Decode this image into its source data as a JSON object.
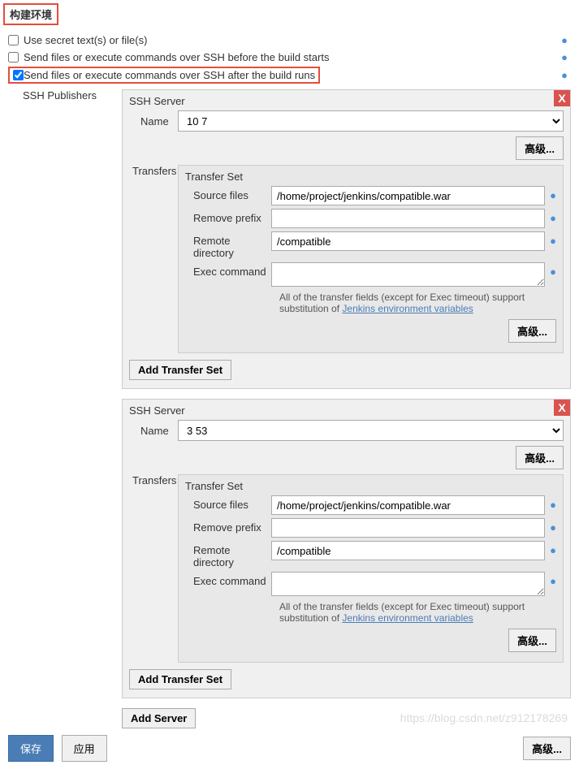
{
  "section_title": "构建环境",
  "checkboxes": {
    "use_secret": {
      "label": "Use secret text(s) or file(s)",
      "checked": false
    },
    "before_build": {
      "label": "Send files or execute commands over SSH before the build starts",
      "checked": false
    },
    "after_build": {
      "label": "Send files or execute commands over SSH after the build runs",
      "checked": true
    }
  },
  "publishers_label": "SSH Publishers",
  "buttons": {
    "advanced": "高级...",
    "add_transfer": "Add Transfer Set",
    "add_server": "Add Server",
    "save": "保存",
    "apply": "应用"
  },
  "close_label": "X",
  "ssh": {
    "server_title": "SSH Server",
    "name_label": "Name",
    "transfers_label": "Transfers",
    "transfer_set_title": "Transfer Set",
    "source_files_label": "Source files",
    "remove_prefix_label": "Remove prefix",
    "remote_dir_label": "Remote directory",
    "exec_cmd_label": "Exec command",
    "hint_text": "All of the transfer fields (except for Exec timeout) support substitution of ",
    "hint_link": "Jenkins environment variables"
  },
  "servers": [
    {
      "name": "10            7",
      "transfer": {
        "source_files": "/home/project/jenkins/compatible.war",
        "remove_prefix": "",
        "remote_directory": "/compatible",
        "exec_command": ""
      }
    },
    {
      "name": "3              53",
      "transfer": {
        "source_files": "/home/project/jenkins/compatible.war",
        "remove_prefix": "",
        "remote_directory": "/compatible",
        "exec_command": ""
      }
    }
  ],
  "watermark": "https://blog.csdn.net/z912178269"
}
